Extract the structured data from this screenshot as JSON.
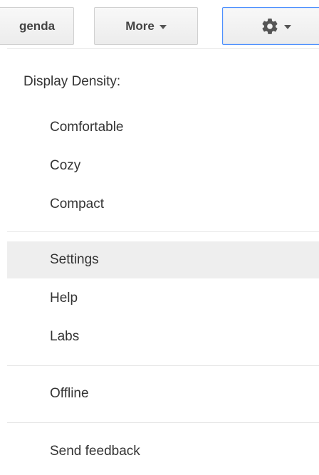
{
  "toolbar": {
    "agenda_label": "genda",
    "more_label": "More",
    "settings_icon": "gear-icon"
  },
  "menu": {
    "heading": "Display Density:",
    "density_options": [
      {
        "label": "Comfortable"
      },
      {
        "label": "Cozy"
      },
      {
        "label": "Compact"
      }
    ],
    "items": [
      {
        "label": "Settings",
        "highlighted": true
      },
      {
        "label": "Help"
      },
      {
        "label": "Labs"
      },
      {
        "label": "Offline"
      },
      {
        "label": "Send feedback"
      }
    ]
  },
  "colors": {
    "focus_border": "#4d90fe",
    "highlight_bg": "#eeeeee",
    "text": "#333333"
  }
}
